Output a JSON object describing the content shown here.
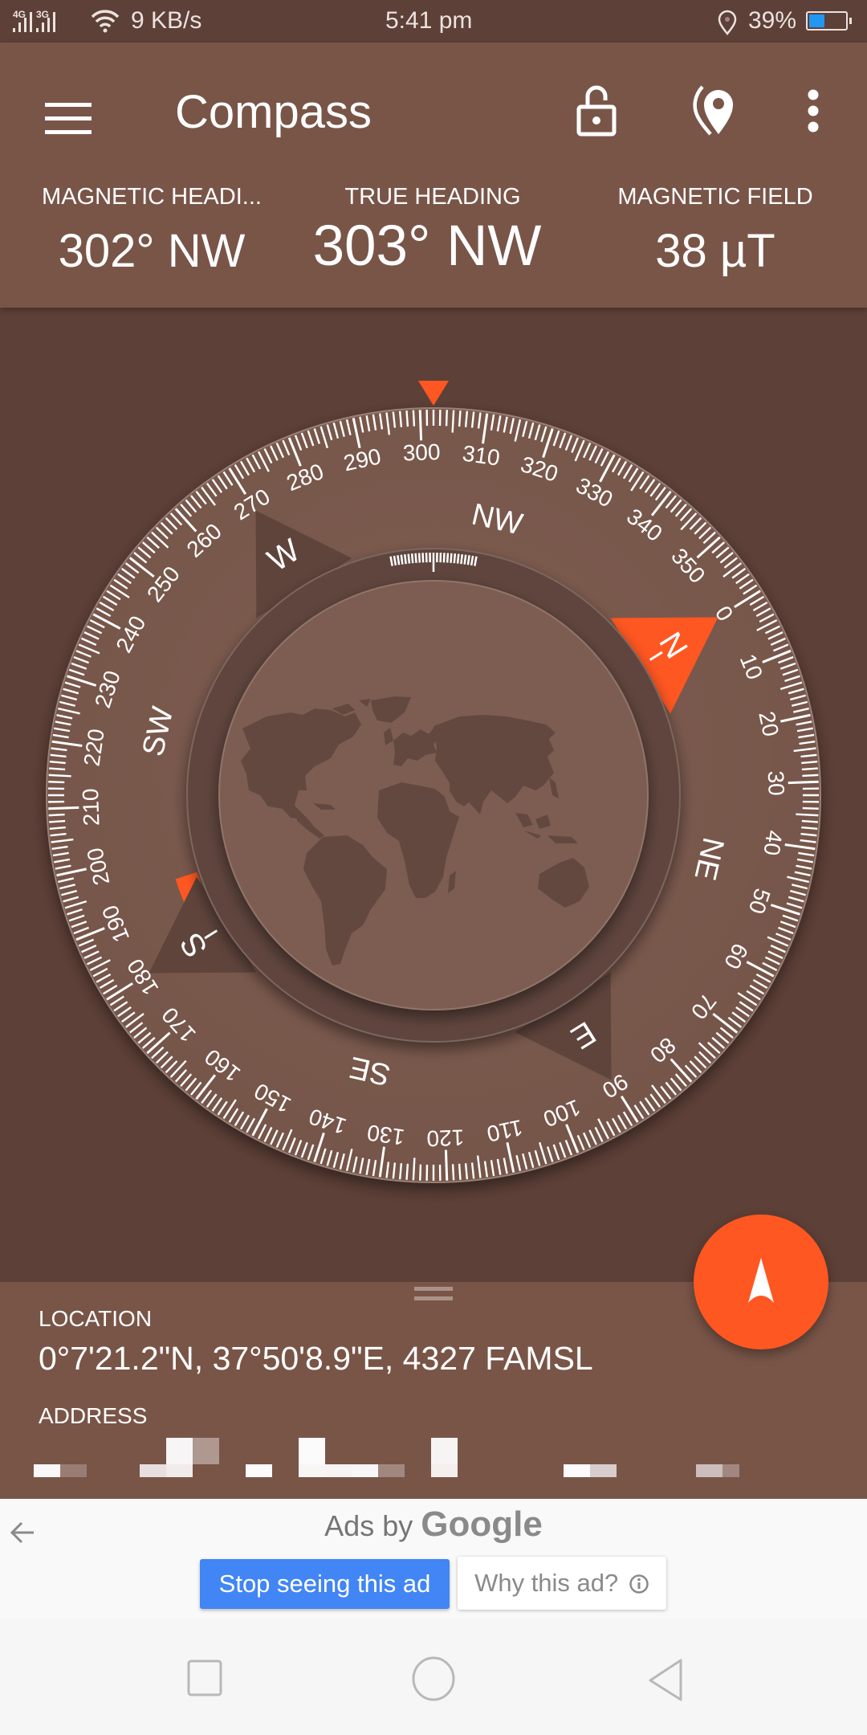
{
  "status_bar": {
    "network_1": "4G",
    "network_2": "3G",
    "speed": "9 KB/s",
    "time": "5:41 pm",
    "battery": "39%",
    "battery_level": 0.39,
    "icons": [
      "signal-4g-icon",
      "signal-3g-icon",
      "wifi-icon",
      "location-icon",
      "battery-icon"
    ]
  },
  "header": {
    "title": "Compass",
    "menu_icon": "hamburger-menu-icon",
    "actions": [
      "lock-open-icon",
      "map-pin-icon",
      "more-vert-icon"
    ],
    "readings": [
      {
        "label": "MAGNETIC HEADI...",
        "value": "302° NW"
      },
      {
        "label": "TRUE HEADING",
        "value": "303° NW"
      },
      {
        "label": "MAGNETIC FIELD",
        "value": "38 µT"
      }
    ]
  },
  "compass": {
    "heading_deg": 302,
    "degree_labels": [
      "0",
      "10",
      "20",
      "30",
      "40",
      "50",
      "60",
      "70",
      "80",
      "90",
      "100",
      "110",
      "120",
      "130",
      "140",
      "150",
      "160",
      "170",
      "180",
      "190",
      "200",
      "210",
      "220",
      "230",
      "240",
      "250",
      "260",
      "270",
      "280",
      "290",
      "300",
      "310",
      "320",
      "330",
      "340",
      "350"
    ],
    "cardinals": [
      {
        "label": "N",
        "deg": 0,
        "highlight": true
      },
      {
        "label": "E",
        "deg": 90,
        "highlight": false
      },
      {
        "label": "S",
        "deg": 180,
        "highlight": false
      },
      {
        "label": "W",
        "deg": 270,
        "highlight": false
      }
    ],
    "intercardinals": [
      {
        "label": "NE",
        "deg": 45
      },
      {
        "label": "SE",
        "deg": 135
      },
      {
        "label": "SW",
        "deg": 225
      },
      {
        "label": "NW",
        "deg": 315
      }
    ],
    "colors": {
      "accent": "#ff5722",
      "dial": "#7b5a4e",
      "ring": "#5f443c",
      "globe": "#7d5d51",
      "land": "#634840"
    }
  },
  "location": {
    "label": "LOCATION",
    "value": "0°7'21.2\"N, 37°50'8.9\"E, 4327 FAMSL",
    "address_label": "ADDRESS",
    "address_value": "(pixelated)"
  },
  "fab": {
    "icon": "navigation-arrow-icon"
  },
  "ads": {
    "title_prefix": "Ads by",
    "title_brand": "Google",
    "back_icon": "back-arrow-icon",
    "stop_label": "Stop seeing this ad",
    "why_label": "Why this ad?",
    "info_icon": "info-icon"
  },
  "nav_bar": {
    "buttons": [
      "recents-square-icon",
      "home-circle-icon",
      "back-triangle-icon"
    ]
  }
}
